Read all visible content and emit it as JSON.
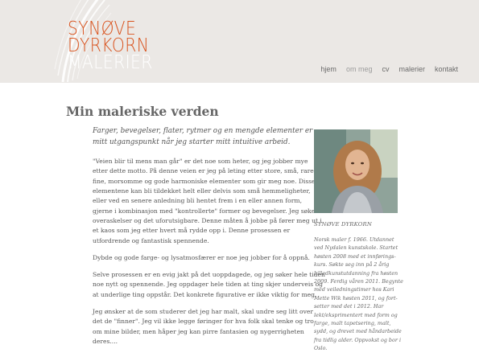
{
  "brand": {
    "line1": "SYNØVE",
    "line2": "DYRKORN",
    "line3": "MALERIER"
  },
  "nav": {
    "items": [
      {
        "label": "hjem",
        "active": false
      },
      {
        "label": "om meg",
        "active": true
      },
      {
        "label": "cv",
        "active": false
      },
      {
        "label": "malerier",
        "active": false
      },
      {
        "label": "kontakt",
        "active": false
      }
    ]
  },
  "page": {
    "title": "Min maleriske verden"
  },
  "content": {
    "lead": [
      "Farger, bevegelser, flater, rytmer og en mengde elementer er",
      "mitt utgangspunkt når jeg starter mitt intuitive arbeid."
    ],
    "paragraphs": [
      [
        "\"Veien blir til mens man går\" er det noe som heter, og jeg jobber mye",
        "etter dette motto. På denne veien er jeg på leting etter store, små, rare,",
        "fine, morsomme og gode harmoniske elementer som gir meg noe. Disse",
        "elementene kan bli tildekket helt eller delvis som små hemmeligheter,",
        "eller ved en senere anledning bli hentet frem i en eller annen form,",
        "gjerne i kombinasjon med \"kontrollerte\" former og bevegelser. Jeg søker",
        "overaskelser og det uforutsigbare. Denne måten å jobbe på fører meg ut i",
        "et kaos som jeg etter hvert må rydde opp i. Denne prosessen er",
        "utfordrende og fantastisk spennende."
      ],
      [
        "Dybde og gode farge- og lysatmosfærer er noe jeg jobber for å oppnå."
      ],
      [
        "Selve prosessen er en evig jakt på det uoppdagede, og jeg søker hele tiden",
        "noe nytt og spennende. Jeg oppdager hele tiden at ting skjer underveis og",
        "at underlige ting oppstår. Det konkrete figurative er ikke viktig for meg."
      ],
      [
        "Jeg ønsker at de som studerer det jeg har malt, skal undre seg litt over",
        "det de \"finner\". Jeg vil ikke legge føringer for hva folk skal tenke og tro",
        "om mine bilder, men håper jeg kan pirre fantasien og nygerrigheten",
        "deres...."
      ]
    ]
  },
  "sidebar": {
    "name": "SYNØVE DYRKORN",
    "bio": [
      "Norsk maler f. 1966. Utdannet",
      "ved Nydalen kunstskole. Startet",
      "høsten 2008 med et innførings-",
      "kurs. Søkte seg inn på 2 årig",
      "billedkunstutdanning fra høsten",
      "2009. Ferdig våren 2011. Begynte",
      "med veiledningstimer hos Kari",
      "Mette Wik høsten 2011, og fort-",
      "setter med det i 2012. Har",
      "lekt/eksprimentert med form og",
      "farge, malt tapetsering, malt,",
      "sydd, og drevet med håndarbeide",
      "fra tidlig alder. Oppvokst og bor i",
      "Oslo."
    ]
  },
  "colors": {
    "header_bg": "#ebe8e5",
    "brand_orange": "#d9531e",
    "text": "#555555"
  }
}
